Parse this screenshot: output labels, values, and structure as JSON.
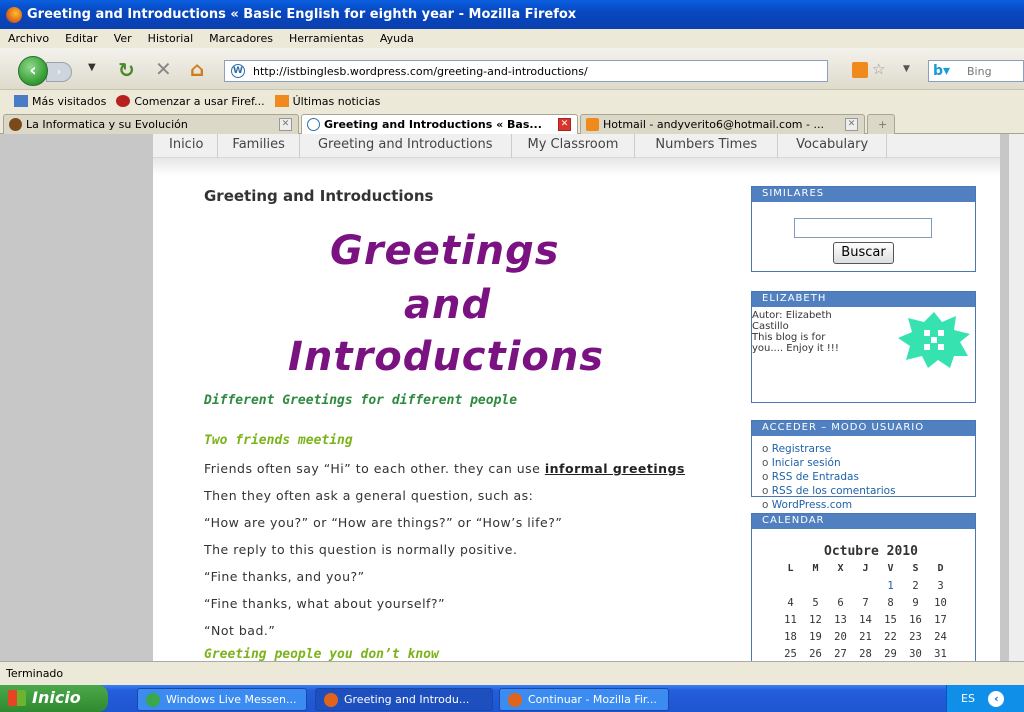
{
  "window": {
    "title": "Greeting and Introductions « Basic English for eighth year - Mozilla Firefox"
  },
  "menu": [
    "Archivo",
    "Editar",
    "Ver",
    "Historial",
    "Marcadores",
    "Herramientas",
    "Ayuda"
  ],
  "url": "http://istbinglesb.wordpress.com/greeting-and-introductions/",
  "search": {
    "placeholder": "Bing"
  },
  "bookmarks": [
    "Más visitados",
    "Comenzar a usar Firef...",
    "Últimas noticias"
  ],
  "tabs": [
    "La Informatica y su Evolución",
    "Greeting and Introductions « Bas...",
    "Hotmail - andyverito6@hotmail.com - ..."
  ],
  "site_nav": [
    "Inicio",
    "Families",
    "Greeting and Introductions",
    "My Classroom",
    "Numbers Times",
    "Vocabulary"
  ],
  "post": {
    "title": "Greeting and Introductions",
    "banner": [
      "Greetings",
      "and",
      "Introductions"
    ],
    "subtitle": "Different Greetings for different people",
    "section1": "Two friends meeting",
    "p1_pre": "Friends often say “Hi” to each other. they can use ",
    "p1_link": "informal greetings",
    "p2": "Then they often ask a general question, such as:",
    "p3": "“How are you?” or “How are things?” or “How’s life?”",
    "p4": "The reply to this question is normally positive.",
    "p5": "“Fine thanks, and you?”",
    "p6": "“Fine thanks, what about yourself?”",
    "p7": "“Not bad.”",
    "section2": "Greeting people you don’t know"
  },
  "sidebar": {
    "similares": {
      "heading": "SIMILARES",
      "button": "Buscar"
    },
    "elizabeth": {
      "heading": "ELIZABETH",
      "l1": "Autor: Elizabeth",
      "l2": "Castillo",
      "l3": "This blog is for",
      "l4": "you.... Enjoy it !!!"
    },
    "acceder": {
      "heading": "ACCEDER – MODO USUARIO",
      "links": [
        "Registrarse",
        "Iniciar sesión",
        "RSS de Entradas",
        "RSS de los comentarios",
        "WordPress.com"
      ]
    },
    "calendar": {
      "heading": "CALENDAR",
      "title": "Octubre 2010",
      "days": [
        "L",
        "M",
        "X",
        "J",
        "V",
        "S",
        "D"
      ],
      "weeks": [
        [
          "",
          "",
          "",
          "",
          "1",
          "2",
          "3"
        ],
        [
          "4",
          "5",
          "6",
          "7",
          "8",
          "9",
          "10"
        ],
        [
          "11",
          "12",
          "13",
          "14",
          "15",
          "16",
          "17"
        ],
        [
          "18",
          "19",
          "20",
          "21",
          "22",
          "23",
          "24"
        ],
        [
          "25",
          "26",
          "27",
          "28",
          "29",
          "30",
          "31"
        ]
      ]
    }
  },
  "status": "Terminado",
  "taskbar": {
    "start": "Inicio",
    "items": [
      "Windows Live Messen...",
      "Greeting and Introdu...",
      "Continuar - Mozilla Fir..."
    ],
    "lang": "ES"
  },
  "colors": {
    "banner": "#7a1281",
    "green": "#2d8a3e",
    "lightgreen": "#7bb31a",
    "widget": "#5080c0"
  }
}
